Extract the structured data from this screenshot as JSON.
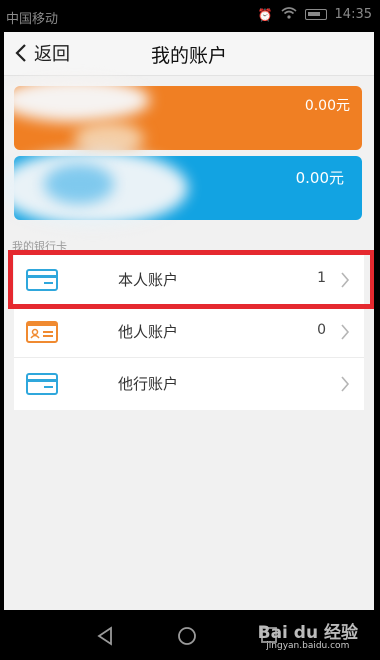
{
  "status_bar": {
    "carrier": "中国移动",
    "time": "14:35"
  },
  "header": {
    "back_label": "返回",
    "title": "我的账户"
  },
  "cards": [
    {
      "amount": "0.00元",
      "color": "#f07f23"
    },
    {
      "amount": "0.00元",
      "color": "#12a3e2"
    }
  ],
  "section_label": "我的银行卡",
  "accounts": [
    {
      "label": "本人账户",
      "count": "1",
      "icon": "bank-card-icon",
      "highlighted": true
    },
    {
      "label": "他人账户",
      "count": "0",
      "icon": "id-card-icon",
      "highlighted": false
    },
    {
      "label": "他行账户",
      "count": "",
      "icon": "bank-card-icon",
      "highlighted": false
    }
  ],
  "watermark": {
    "brand": "Bai du 经验",
    "url": "jingyan.baidu.com"
  },
  "colors": {
    "orange_card": "#f07f23",
    "blue_card": "#12a3e2",
    "highlight_red": "#e5292f"
  }
}
